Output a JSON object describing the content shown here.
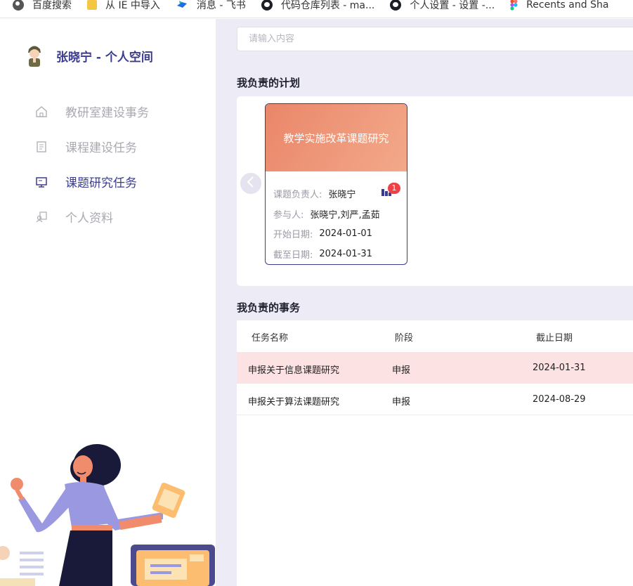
{
  "bookmarks": [
    {
      "label": "百度搜索",
      "icon": "globe-icon"
    },
    {
      "label": "从 IE 中导入",
      "icon": "folder-icon"
    },
    {
      "label": "消息 - 飞书",
      "icon": "feishu-icon"
    },
    {
      "label": "代码仓库列表 - ma...",
      "icon": "github-icon"
    },
    {
      "label": "个人设置 - 设置 -...",
      "icon": "github-icon"
    },
    {
      "label": "Recents and Sha",
      "icon": "figma-icon"
    }
  ],
  "sidebar": {
    "title": "张晓宁 - 个人空间",
    "items": [
      {
        "label": "教研室建设事务",
        "icon": "home-icon",
        "active": false
      },
      {
        "label": "课程建设任务",
        "icon": "document-icon",
        "active": false
      },
      {
        "label": "课题研究任务",
        "icon": "monitor-icon",
        "active": true
      },
      {
        "label": "个人资料",
        "icon": "profile-icon",
        "active": false
      }
    ]
  },
  "search": {
    "placeholder": "请输入内容"
  },
  "plans": {
    "title": "我负责的计划",
    "card": {
      "title": "教学实施改革课题研究",
      "leader_label": "课题负责人:",
      "leader": "张晓宁",
      "badge_count": "1",
      "members_label": "参与人:",
      "members": "张晓宁,刘严,孟茹",
      "start_label": "开始日期:",
      "start": "2024-01-01",
      "end_label": "截至日期:",
      "end": "2024-01-31"
    }
  },
  "tasks": {
    "title": "我负责的事务",
    "columns": [
      "任务名称",
      "阶段",
      "截止日期"
    ],
    "rows": [
      {
        "name": "申报关于信息课题研究",
        "stage": "申报",
        "deadline": "2024-01-31",
        "highlighted": true
      },
      {
        "name": "申报关于算法课题研究",
        "stage": "申报",
        "deadline": "2024-08-29",
        "highlighted": false
      }
    ]
  },
  "colors": {
    "accent": "#3b3c8e",
    "banner": "#ea866a",
    "highlight_row": "#fce2e2",
    "badge": "#ee4045",
    "main_bg": "#ecebf6"
  }
}
